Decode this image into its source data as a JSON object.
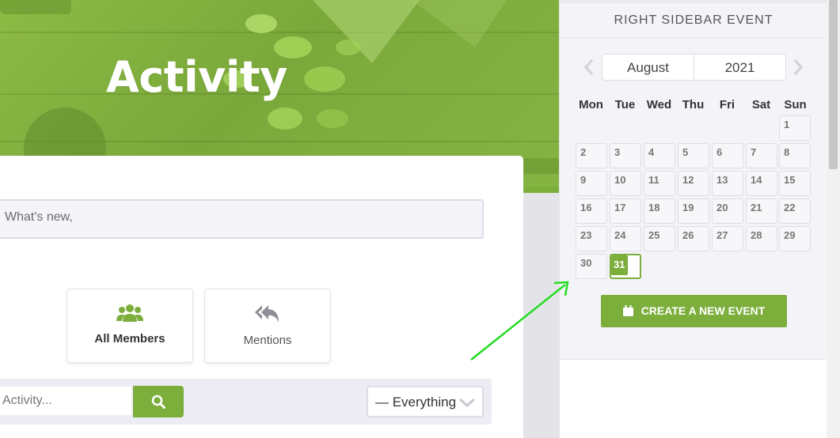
{
  "hero": {
    "title": "Activity"
  },
  "activity": {
    "whats_new_placeholder": "What's new,",
    "tabs": [
      {
        "label": "All Members",
        "icon": "users-icon",
        "active": true
      },
      {
        "label": "Mentions",
        "icon": "reply-all-icon",
        "active": false
      }
    ],
    "search_placeholder": "Activity...",
    "filter_selected": "— Everything"
  },
  "sidebar": {
    "title": "RIGHT SIDEBAR EVENT",
    "calendar": {
      "month": "August",
      "year": "2021",
      "weekdays": [
        "Mon",
        "Tue",
        "Wed",
        "Thu",
        "Fri",
        "Sat",
        "Sun"
      ],
      "days": [
        "1",
        "2",
        "3",
        "4",
        "5",
        "6",
        "7",
        "8",
        "9",
        "10",
        "11",
        "12",
        "13",
        "14",
        "15",
        "16",
        "17",
        "18",
        "19",
        "20",
        "21",
        "22",
        "23",
        "24",
        "25",
        "26",
        "27",
        "28",
        "29",
        "30",
        "31"
      ],
      "today": "31"
    },
    "create_button": "CREATE A NEW EVENT"
  },
  "colors": {
    "accent": "#7cae3c",
    "arrow": "#22dd22"
  }
}
